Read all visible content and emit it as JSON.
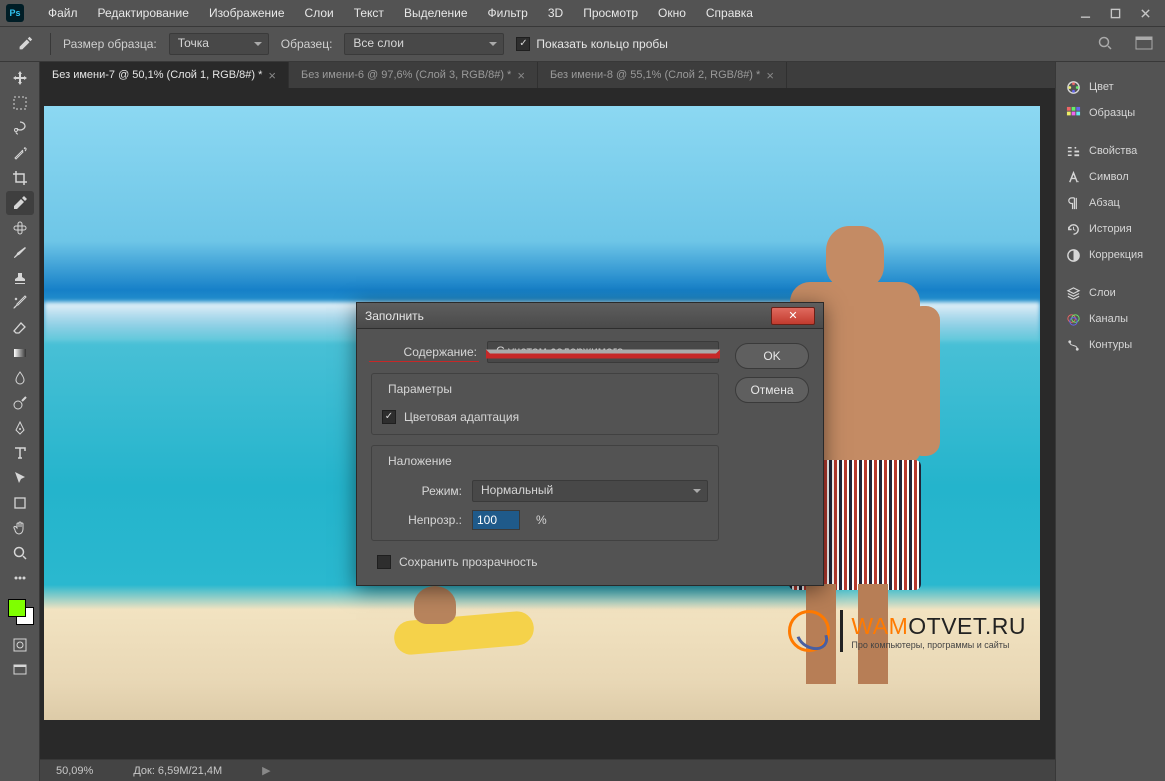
{
  "menu": {
    "items": [
      "Файл",
      "Редактирование",
      "Изображение",
      "Слои",
      "Текст",
      "Выделение",
      "Фильтр",
      "3D",
      "Просмотр",
      "Окно",
      "Справка"
    ]
  },
  "optionsBar": {
    "sampleSizeLabel": "Размер образца:",
    "sampleSizeValue": "Точка",
    "sampleLabel": "Образец:",
    "sampleValue": "Все слои",
    "showRingLabel": "Показать кольцо пробы"
  },
  "tabs": [
    {
      "label": "Без имени-7 @ 50,1% (Слой 1, RGB/8#) *",
      "active": true
    },
    {
      "label": "Без имени-6 @ 97,6% (Слой 3, RGB/8#) *",
      "active": false
    },
    {
      "label": "Без имени-8 @ 55,1% (Слой 2, RGB/8#) *",
      "active": false
    }
  ],
  "panels": [
    "Цвет",
    "Образцы",
    "Свойства",
    "Символ",
    "Абзац",
    "История",
    "Коррекция",
    "Слои",
    "Каналы",
    "Контуры"
  ],
  "statusbar": {
    "zoom": "50,09%",
    "doc": "Док: 6,59M/21,4M"
  },
  "dialog": {
    "title": "Заполнить",
    "content_label": "Содержание:",
    "content_value": "С учетом содержимого",
    "params_legend": "Параметры",
    "params_chk": "Цветовая адаптация",
    "overlay_legend": "Наложение",
    "mode_label": "Режим:",
    "mode_value": "Нормальный",
    "opacity_label": "Непрозр.:",
    "opacity_value": "100",
    "opacity_unit": "%",
    "preserve_label": "Сохранить прозрачность",
    "ok": "OK",
    "cancel": "Отмена"
  },
  "watermark": {
    "brand1": "WAM",
    "brand2": "OTVET",
    "brand3": ".RU",
    "sub": "Про компьютеры, программы и сайты"
  },
  "colors": {
    "fg": "#7fff00",
    "bg": "#ffffff"
  }
}
